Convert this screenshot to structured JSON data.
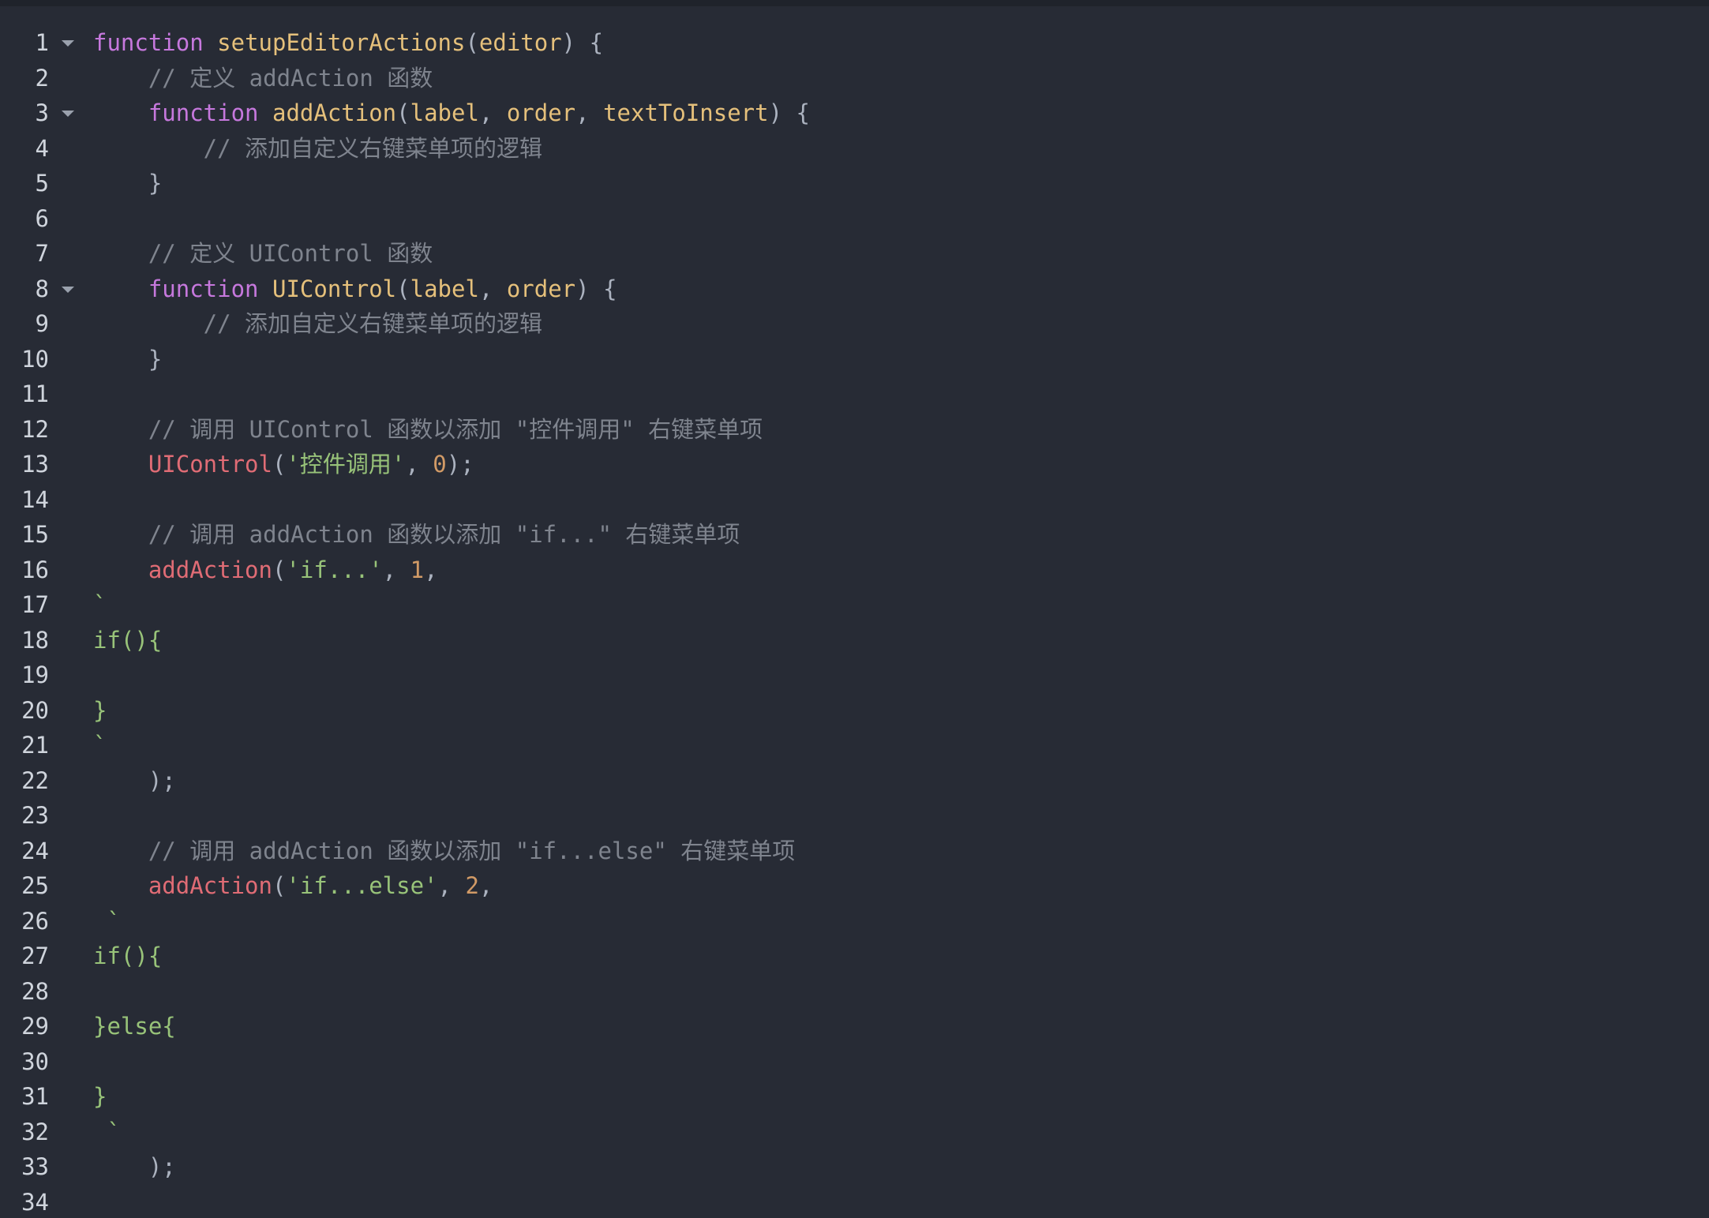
{
  "editor": {
    "lines": [
      {
        "n": "1",
        "fold": true,
        "tokens": [
          {
            "c": "kw",
            "t": "function"
          },
          {
            "c": "pl",
            "t": " "
          },
          {
            "c": "fn",
            "t": "setupEditorActions"
          },
          {
            "c": "pl",
            "t": "("
          },
          {
            "c": "prm",
            "t": "editor"
          },
          {
            "c": "pl",
            "t": ") {"
          }
        ]
      },
      {
        "n": "2",
        "tokens": [
          {
            "c": "cm",
            "t": "    // 定义 addAction 函数"
          }
        ]
      },
      {
        "n": "3",
        "fold": true,
        "tokens": [
          {
            "c": "pl",
            "t": "    "
          },
          {
            "c": "kw",
            "t": "function"
          },
          {
            "c": "pl",
            "t": " "
          },
          {
            "c": "fn",
            "t": "addAction"
          },
          {
            "c": "pl",
            "t": "("
          },
          {
            "c": "prm",
            "t": "label"
          },
          {
            "c": "pl",
            "t": ", "
          },
          {
            "c": "prm",
            "t": "order"
          },
          {
            "c": "pl",
            "t": ", "
          },
          {
            "c": "prm",
            "t": "textToInsert"
          },
          {
            "c": "pl",
            "t": ") {"
          }
        ]
      },
      {
        "n": "4",
        "tokens": [
          {
            "c": "cm",
            "t": "        // 添加自定义右键菜单项的逻辑"
          }
        ]
      },
      {
        "n": "5",
        "tokens": [
          {
            "c": "pl",
            "t": "    }"
          }
        ]
      },
      {
        "n": "6",
        "tokens": []
      },
      {
        "n": "7",
        "tokens": [
          {
            "c": "cm",
            "t": "    // 定义 UIControl 函数"
          }
        ]
      },
      {
        "n": "8",
        "fold": true,
        "tokens": [
          {
            "c": "pl",
            "t": "    "
          },
          {
            "c": "kw",
            "t": "function"
          },
          {
            "c": "pl",
            "t": " "
          },
          {
            "c": "fn",
            "t": "UIControl"
          },
          {
            "c": "pl",
            "t": "("
          },
          {
            "c": "prm",
            "t": "label"
          },
          {
            "c": "pl",
            "t": ", "
          },
          {
            "c": "prm",
            "t": "order"
          },
          {
            "c": "pl",
            "t": ") {"
          }
        ]
      },
      {
        "n": "9",
        "tokens": [
          {
            "c": "cm",
            "t": "        // 添加自定义右键菜单项的逻辑"
          }
        ]
      },
      {
        "n": "10",
        "tokens": [
          {
            "c": "pl",
            "t": "    }"
          }
        ]
      },
      {
        "n": "11",
        "tokens": []
      },
      {
        "n": "12",
        "tokens": [
          {
            "c": "cm",
            "t": "    // 调用 UIControl 函数以添加 \"控件调用\" 右键菜单项"
          }
        ]
      },
      {
        "n": "13",
        "tokens": [
          {
            "c": "pl",
            "t": "    "
          },
          {
            "c": "call",
            "t": "UIControl"
          },
          {
            "c": "pl",
            "t": "("
          },
          {
            "c": "str",
            "t": "'控件调用'"
          },
          {
            "c": "pl",
            "t": ", "
          },
          {
            "c": "num",
            "t": "0"
          },
          {
            "c": "pl",
            "t": ");"
          }
        ]
      },
      {
        "n": "14",
        "tokens": []
      },
      {
        "n": "15",
        "tokens": [
          {
            "c": "cm",
            "t": "    // 调用 addAction 函数以添加 \"if...\" 右键菜单项"
          }
        ]
      },
      {
        "n": "16",
        "tokens": [
          {
            "c": "pl",
            "t": "    "
          },
          {
            "c": "call",
            "t": "addAction"
          },
          {
            "c": "pl",
            "t": "("
          },
          {
            "c": "str",
            "t": "'if...'"
          },
          {
            "c": "pl",
            "t": ", "
          },
          {
            "c": "num",
            "t": "1"
          },
          {
            "c": "pl",
            "t": ","
          }
        ]
      },
      {
        "n": "17",
        "tokens": [
          {
            "c": "str",
            "t": "`"
          }
        ]
      },
      {
        "n": "18",
        "tokens": [
          {
            "c": "str",
            "t": "if(){"
          }
        ]
      },
      {
        "n": "19",
        "tokens": []
      },
      {
        "n": "20",
        "tokens": [
          {
            "c": "str",
            "t": "}"
          }
        ]
      },
      {
        "n": "21",
        "tokens": [
          {
            "c": "str",
            "t": "`"
          }
        ]
      },
      {
        "n": "22",
        "tokens": [
          {
            "c": "pl",
            "t": "    );"
          }
        ]
      },
      {
        "n": "23",
        "tokens": []
      },
      {
        "n": "24",
        "tokens": [
          {
            "c": "cm",
            "t": "    // 调用 addAction 函数以添加 \"if...else\" 右键菜单项"
          }
        ]
      },
      {
        "n": "25",
        "tokens": [
          {
            "c": "pl",
            "t": "    "
          },
          {
            "c": "call",
            "t": "addAction"
          },
          {
            "c": "pl",
            "t": "("
          },
          {
            "c": "str",
            "t": "'if...else'"
          },
          {
            "c": "pl",
            "t": ", "
          },
          {
            "c": "num",
            "t": "2"
          },
          {
            "c": "pl",
            "t": ","
          }
        ]
      },
      {
        "n": "26",
        "tokens": [
          {
            "c": "str",
            "t": " `"
          }
        ]
      },
      {
        "n": "27",
        "tokens": [
          {
            "c": "str",
            "t": "if(){"
          }
        ]
      },
      {
        "n": "28",
        "tokens": []
      },
      {
        "n": "29",
        "tokens": [
          {
            "c": "str",
            "t": "}else{"
          }
        ]
      },
      {
        "n": "30",
        "tokens": []
      },
      {
        "n": "31",
        "tokens": [
          {
            "c": "str",
            "t": "}"
          }
        ]
      },
      {
        "n": "32",
        "tokens": [
          {
            "c": "str",
            "t": " `"
          }
        ]
      },
      {
        "n": "33",
        "tokens": [
          {
            "c": "pl",
            "t": "    );"
          }
        ]
      },
      {
        "n": "34",
        "tokens": []
      }
    ]
  }
}
